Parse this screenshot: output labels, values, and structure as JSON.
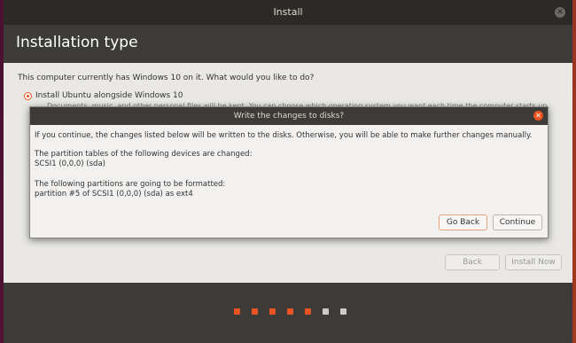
{
  "window": {
    "title": "Install",
    "header_title": "Installation type"
  },
  "content": {
    "question": "This computer currently has Windows 10 on it. What would you like to do?",
    "option_label": "Install Ubuntu alongside Windows 10",
    "option_desc": "Documents, music, and other personal files will be kept. You can choose which operating system you want each time the computer starts up."
  },
  "buttons": {
    "back": "Back",
    "install_now": "Install Now"
  },
  "dialog": {
    "title": "Write the changes to disks?",
    "intro": "If you continue, the changes listed below will be written to the disks. Otherwise, you will be able to make further changes manually.",
    "partition_tables_heading": "The partition tables of the following devices are changed:",
    "partition_tables_device": "SCSI1 (0,0,0) (sda)",
    "format_heading": "The following partitions are going to be formatted:",
    "format_partition": "partition #5 of SCSI1 (0,0,0) (sda) as ext4",
    "go_back": "Go Back",
    "continue": "Continue"
  },
  "progress": {
    "steps_total": 7,
    "steps_done": 5,
    "active_color": "#e95420",
    "inactive_color": "#cfcac6"
  }
}
